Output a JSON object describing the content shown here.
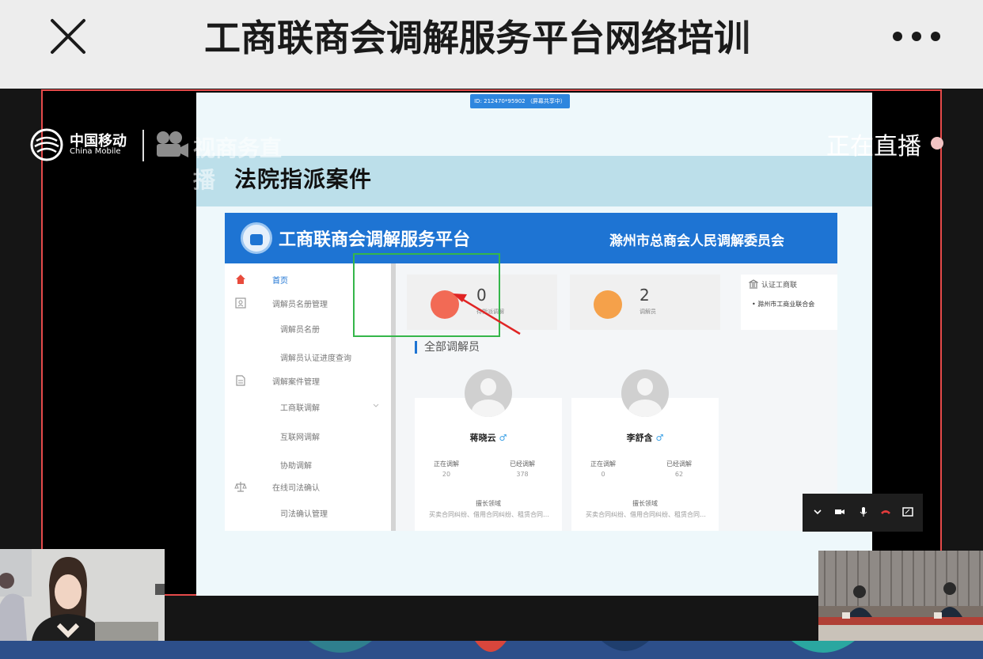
{
  "top_bar": {
    "title": "工商联商会调解服务平台网络培训",
    "close_icon": "close-icon",
    "more_icon": "more-icon"
  },
  "live": {
    "brand_cn": "中国移动",
    "brand_en": "China Mobile",
    "brand_service": "视商务直播",
    "status": "正在直播",
    "status_dot_color": "#f1c3c3"
  },
  "slide": {
    "meeting_id": "ID: 212470*95902 （屏幕共享中）",
    "heading": "法院指派案件"
  },
  "app": {
    "title": "工商联商会调解服务平台",
    "org": "滁州市总商会人民调解委员会",
    "accent_color": "#1e74d3",
    "nav": [
      {
        "label": "首页",
        "icon": "home-icon",
        "active": true
      },
      {
        "label": "调解员名册管理",
        "icon": "user-card-icon"
      },
      {
        "label": "调解员名册"
      },
      {
        "label": "调解员认证进度查询"
      },
      {
        "label": "调解案件管理",
        "icon": "document-icon"
      },
      {
        "label": "工商联调解",
        "icon": "chevron-down-icon"
      },
      {
        "label": "互联网调解"
      },
      {
        "label": "协助调解"
      },
      {
        "label": "在线司法确认",
        "icon": "scales-icon"
      },
      {
        "label": "司法确认管理"
      }
    ],
    "stats": [
      {
        "value": "0",
        "label": "待指派调解",
        "icon": "hand-icon",
        "color": "#f26a55"
      },
      {
        "value": "2",
        "label": "调解员",
        "icon": "group-icon",
        "color": "#f5a14a"
      }
    ],
    "cert": {
      "heading": "认证工商联",
      "item": "滁州市工商业联合会"
    },
    "section_title": "全部调解员",
    "mediators": [
      {
        "name": "蒋晓云",
        "gender_symbol": "♂",
        "col1": "正在调解",
        "col1_value": "20",
        "col2": "已经调解",
        "col2_value": "378",
        "field_label": "擅长领域",
        "fields": "买卖合同纠纷、借用合同纠纷、租赁合同…"
      },
      {
        "name": "李舒含",
        "gender_symbol": "♂",
        "col1": "正在调解",
        "col1_value": "0",
        "col2": "已经调解",
        "col2_value": "62",
        "field_label": "擅长领域",
        "fields": "买卖合同纠纷、借用合同纠纷、租赁合同…"
      }
    ]
  },
  "controls": [
    "chevron-down-icon",
    "camera-icon",
    "microphone-icon",
    "hang-up-icon",
    "screen-icon"
  ],
  "annotation_colors": {
    "box": "#35b64a",
    "arrow": "#e02424"
  }
}
